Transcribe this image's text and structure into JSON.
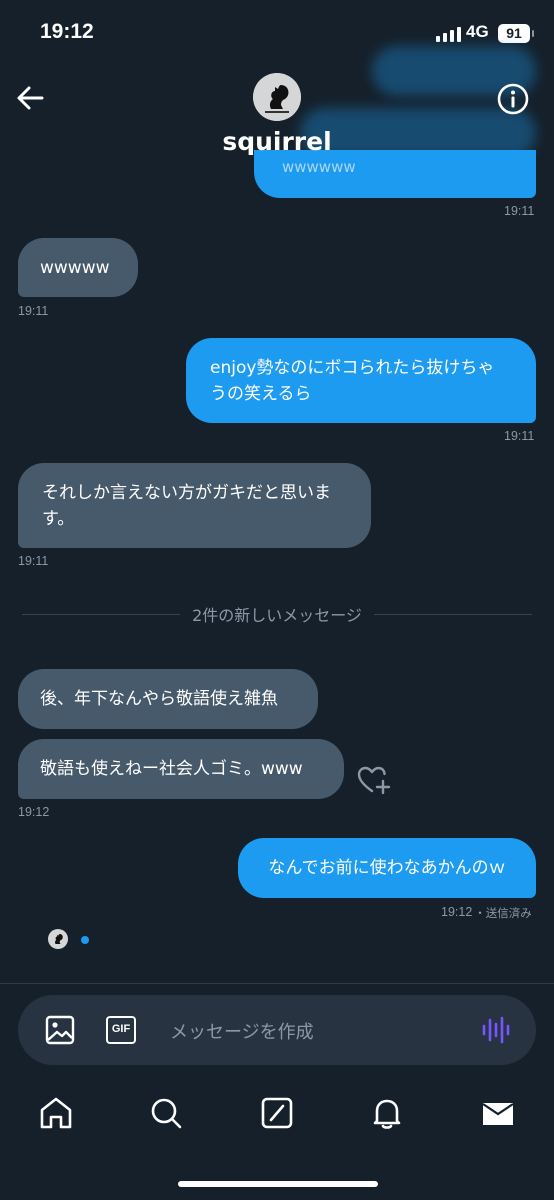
{
  "status_bar": {
    "time": "19:12",
    "network": "4G",
    "battery": "91"
  },
  "header": {
    "title": "squirrel",
    "back_icon": "back-arrow-icon",
    "info_icon": "info-icon",
    "avatar_icon": "squirrel-avatar"
  },
  "messages": [
    {
      "side": "received",
      "text": "wwwww",
      "time": "19:11"
    },
    {
      "side": "sent",
      "lines": [
        "enjoy勢なのにボコられたら抜けちゃ",
        "うの笑えるら"
      ],
      "time": "19:11"
    },
    {
      "side": "received",
      "lines": [
        "それしか言えない方がガキだと思いま",
        "す。"
      ],
      "time": "19:11"
    },
    {
      "side": "received",
      "text": "後、年下なんやら敬語使え雑魚"
    },
    {
      "side": "received",
      "text": "敬語も使えねー社会人ゴミ。www",
      "time": "19:12"
    },
    {
      "side": "sent",
      "text": "なんでお前に使わなあかんのｗ",
      "time": "19:12",
      "status": "・送信済み"
    }
  ],
  "prev_sent_time": "19:11",
  "prev_sent_text": "wwwwww",
  "divider": "2件の新しいメッセージ",
  "composer": {
    "placeholder": "メッセージを作成",
    "gif_label": "GIF"
  },
  "nav": [
    "home-icon",
    "search-icon",
    "grok-icon",
    "bell-icon",
    "mail-icon"
  ],
  "colors": {
    "background": "#15202b",
    "sent_bubble": "#1d9bf0",
    "received_bubble": "#475a6b",
    "accent_voice": "#7856ff"
  }
}
